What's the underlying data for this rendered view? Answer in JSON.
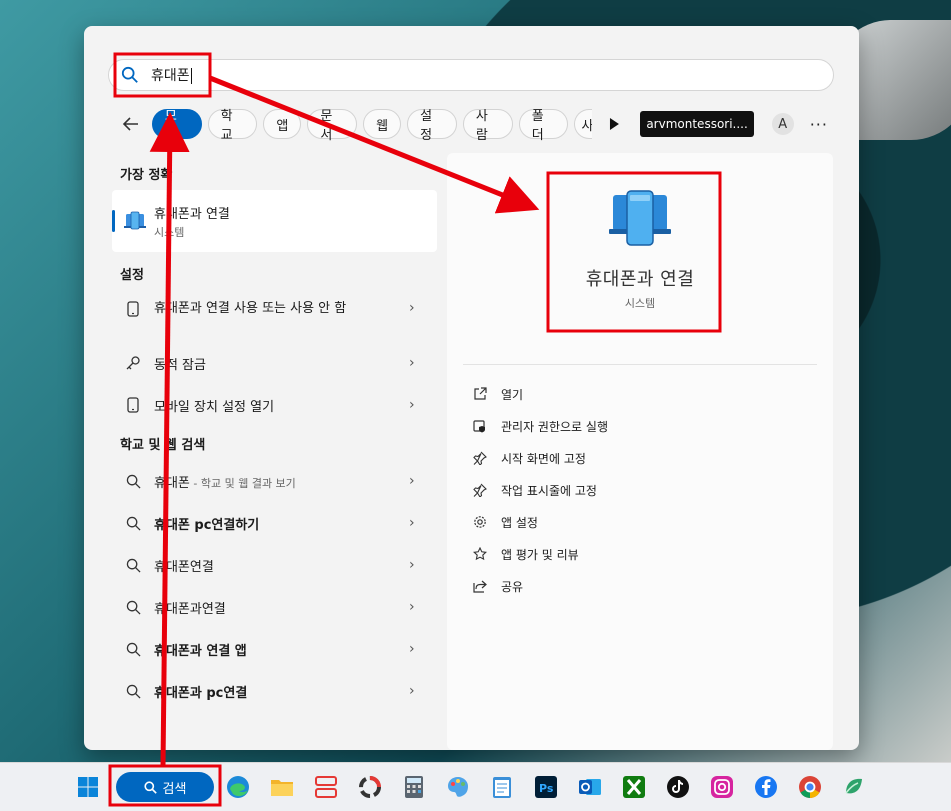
{
  "search": {
    "query": "휴대폰"
  },
  "filters": {
    "chips": [
      "모두",
      "학교",
      "앱",
      "문서",
      "웹",
      "설정",
      "사람",
      "폴더"
    ],
    "clipped_chip": "사",
    "org": "arvmontessori....",
    "avatar_letter": "A",
    "more": "···"
  },
  "best_match": {
    "title": "가장 정확",
    "app_name": "휴대폰과 연결",
    "app_type": "시스템"
  },
  "settings": {
    "title": "설정",
    "items": [
      "휴대폰과 연결 사용 또는 사용 안 함",
      "동적 잠금",
      "모바일 장치 설정 열기"
    ]
  },
  "web": {
    "title": "학교 및 웹 검색",
    "first_main": "휴대폰",
    "first_hint": " - 학교 및 웹 결과 보기",
    "items": [
      "휴대폰 pc연결하기",
      "휴대폰연결",
      "휴대폰과연결",
      "휴대폰과 연결 앱",
      "휴대폰과 pc연결"
    ]
  },
  "preview": {
    "app_name": "휴대폰과 연결",
    "app_type": "시스템",
    "actions": [
      "열기",
      "관리자 권한으로 실행",
      "시작 화면에 고정",
      "작업 표시줄에 고정",
      "앱 설정",
      "앱 평가 및 리뷰",
      "공유"
    ]
  },
  "taskbar": {
    "search_label": "검색",
    "icons": [
      "windows-start",
      "edge",
      "file-explorer",
      "snipping",
      "progress",
      "calculator",
      "paint",
      "notepad",
      "photoshop",
      "outlook",
      "xbox",
      "tiktok",
      "instagram",
      "facebook",
      "chrome",
      "copilot"
    ]
  },
  "colors": {
    "accent": "#0067c0",
    "annotation_red": "#e8000b"
  }
}
